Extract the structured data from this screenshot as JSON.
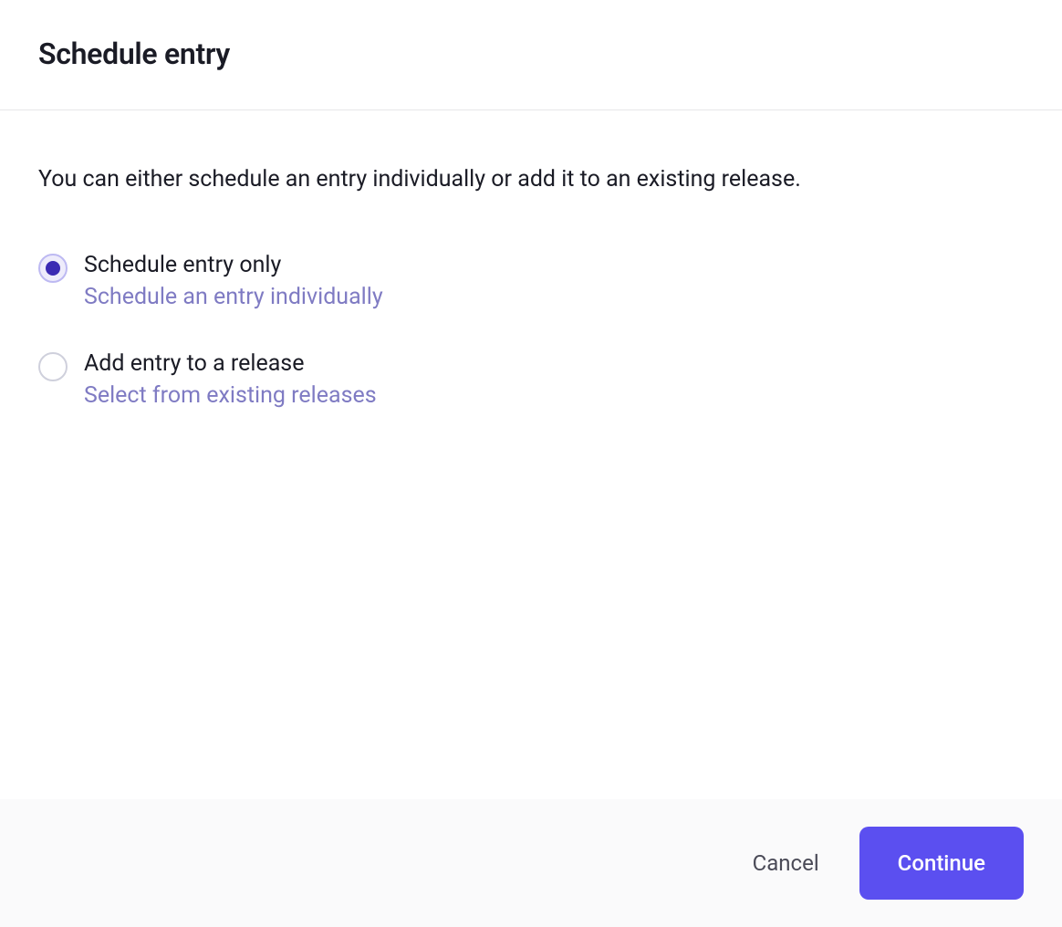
{
  "header": {
    "title": "Schedule entry"
  },
  "content": {
    "description": "You can either schedule an entry individually or add it to an existing release."
  },
  "options": [
    {
      "label": "Schedule entry only",
      "sublabel": "Schedule an entry individually",
      "selected": true
    },
    {
      "label": "Add entry to a release",
      "sublabel": "Select from existing releases",
      "selected": false
    }
  ],
  "footer": {
    "cancel_label": "Cancel",
    "continue_label": "Continue"
  }
}
